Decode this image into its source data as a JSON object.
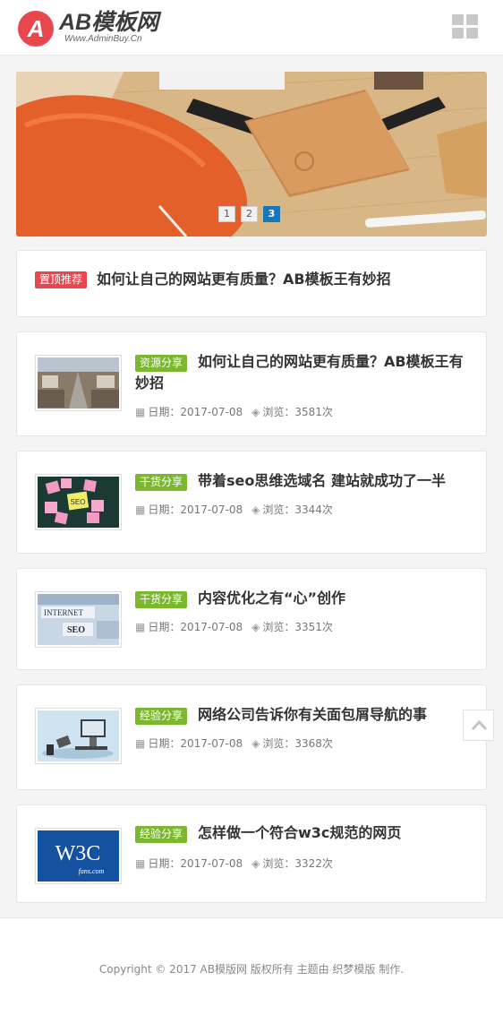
{
  "header": {
    "logo_mark": "A",
    "logo_title": "AB模板网",
    "logo_subtitle": "Www.AdminBuy.Cn",
    "menu_icon": "grid-menu-icon"
  },
  "banner": {
    "pages": [
      "1",
      "2",
      "3"
    ],
    "active_page": "3"
  },
  "featured": {
    "tag": "置顶推荐",
    "title": "如何让自己的网站更有质量？AB模板王有妙招"
  },
  "articles": [
    {
      "tag": "资源分享",
      "title_line1": "如何让自己的网站更有质量？AB模板王有",
      "title_line2": "妙招",
      "date_label": "日期：2017-07-08",
      "views_label": "浏览：3581次"
    },
    {
      "tag": "干货分享",
      "title_line1": "带着seo思维选域名 建站就成功了一半",
      "date_label": "日期：2017-07-08",
      "views_label": "浏览：3344次"
    },
    {
      "tag": "干货分享",
      "title_line1": "内容优化之有“心”创作",
      "date_label": "日期：2017-07-08",
      "views_label": "浏览：3351次"
    },
    {
      "tag": "经验分享",
      "title_line1": "网络公司告诉你有关面包屑导航的事",
      "date_label": "日期：2017-07-08",
      "views_label": "浏览：3368次"
    },
    {
      "tag": "经验分享",
      "title_line1": "怎样做一个符合w3c规范的网页",
      "date_label": "日期：2017-07-08",
      "views_label": "浏览：3322次"
    }
  ],
  "thumbs": {
    "thumb2_words": [
      "SEO"
    ],
    "thumb3_words": [
      "INTERNET",
      "SEO"
    ],
    "thumb5_words": [
      "W3C",
      "fans.com"
    ]
  },
  "footer": {
    "copyright": "Copyright © 2017 AB模版网 版权所有 主题由 织梦模版 制作."
  },
  "colors": {
    "accent_red": "#e9474e",
    "tag_green": "#7cb82f",
    "pager_blue": "#1a77b5"
  }
}
